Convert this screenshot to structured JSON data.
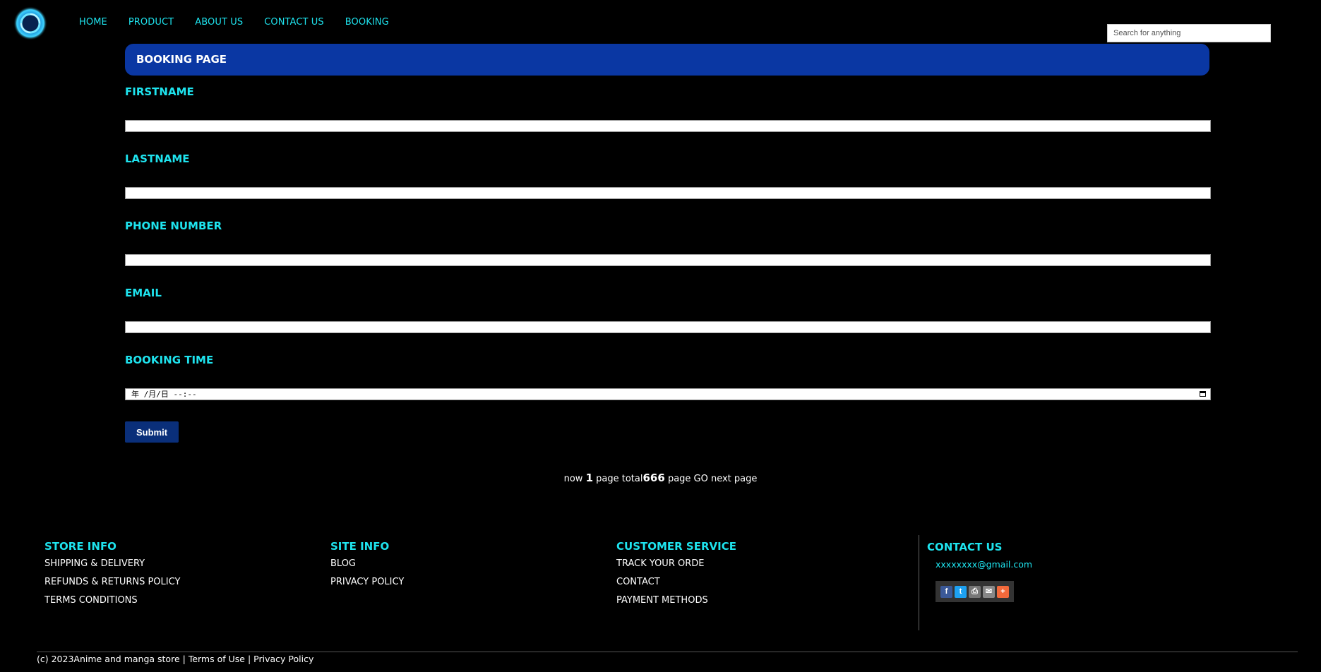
{
  "nav": {
    "items": [
      "HOME",
      "PRODUCT",
      "ABOUT US",
      "CONTACT US",
      "BOOKING"
    ]
  },
  "search": {
    "placeholder": "Search for anything"
  },
  "banner": {
    "title": "BOOKING PAGE"
  },
  "form": {
    "firstname_label": "FIRSTNAME",
    "lastname_label": "LASTNAME",
    "phone_label": "PHONE NUMBER",
    "email_label": "EMAIL",
    "booking_time_label": "BOOKING TIME",
    "booking_time_value": "年 /月/日 --:--",
    "submit_label": "Submit"
  },
  "pagination": {
    "now_text": "now",
    "current_page": "1",
    "page_total_text": "page total",
    "total_pages": "666",
    "tail_text": "page GO next page"
  },
  "footer": {
    "store_info": {
      "heading": "STORE INFO",
      "links": [
        "SHIPPING & DELIVERY",
        "REFUNDS & RETURNS POLICY",
        "TERMS CONDITIONS"
      ]
    },
    "site_info": {
      "heading": "SITE INFO",
      "links": [
        "BLOG",
        "PRIVACY POLICY"
      ]
    },
    "customer_service": {
      "heading": "CUSTOMER SERVICE",
      "links": [
        "TRACK YOUR ORDE",
        "CONTACT",
        "PAYMENT METHODS"
      ]
    },
    "contact_us": {
      "heading": "CONTACT US",
      "email": "xxxxxxxx@gmail.com"
    },
    "share": [
      {
        "icon": "facebook-icon",
        "glyph": "f",
        "color": "#3b5998"
      },
      {
        "icon": "twitter-icon",
        "glyph": "t",
        "color": "#1da1f2"
      },
      {
        "icon": "print-icon",
        "glyph": "⎙",
        "color": "#777777"
      },
      {
        "icon": "mail-icon",
        "glyph": "✉",
        "color": "#888888"
      },
      {
        "icon": "plus-icon",
        "glyph": "+",
        "color": "#f2693b"
      }
    ]
  },
  "copyright": {
    "text": "(c) 2023Anime and manga store |",
    "terms": "Terms of Use",
    "separator": "|",
    "privacy": "Privacy Policy"
  },
  "colors": {
    "accent": "#1ee3ee",
    "banner": "#0a37a3",
    "submit": "#0a2f7a",
    "background": "#000000"
  }
}
